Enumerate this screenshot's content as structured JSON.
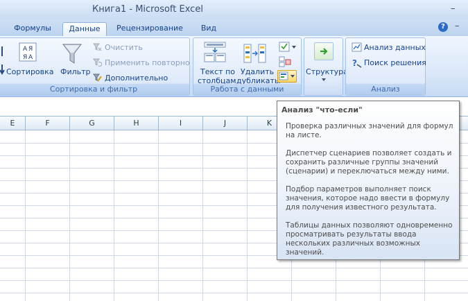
{
  "window": {
    "title": "Книга1 - Microsoft Excel",
    "minimize": "–",
    "help": "?",
    "restore": "–"
  },
  "tabs": [
    {
      "label": "Формулы",
      "active": false
    },
    {
      "label": "Данные",
      "active": true
    },
    {
      "label": "Рецензирование",
      "active": false
    },
    {
      "label": "Вид",
      "active": false
    }
  ],
  "ribbon": {
    "sort_filter": {
      "label": "Сортировка и фильтр",
      "sort": "Сортировка",
      "filter": "Фильтр",
      "clear": "Очистить",
      "reapply": "Применить повторно",
      "advanced": "Дополнительно"
    },
    "data_tools": {
      "label": "Работа с данными",
      "text_to_columns_1": "Текст по",
      "text_to_columns_2": "столбцам",
      "remove_dup_1": "Удалить",
      "remove_dup_2": "дубликаты"
    },
    "outline": {
      "label": "Структура"
    },
    "analysis": {
      "label": "Анализ",
      "data_analysis": "Анализ данных",
      "solver": "Поиск решения"
    }
  },
  "grid": {
    "columns": [
      "E",
      "F",
      "G",
      "H",
      "I",
      "J",
      "K"
    ]
  },
  "tooltip": {
    "title": "Анализ \"что-если\"",
    "paragraphs": [
      "Проверка различных значений для формул на листе.",
      "Диспетчер сценариев позволяет создать и сохранить различные группы значений (сценарии) и переключаться между ними.",
      "Подбор параметров выполняет поиск значения, которое надо ввести в формулу для получения известного результата.",
      "Таблицы данных позволяют одновременно просматривать результаты ввода нескольких различных возможных значений."
    ]
  },
  "colors": {
    "accent": "#15428b",
    "ribbon_bg": "#dbe8f9",
    "tooltip_border": "#767676"
  }
}
